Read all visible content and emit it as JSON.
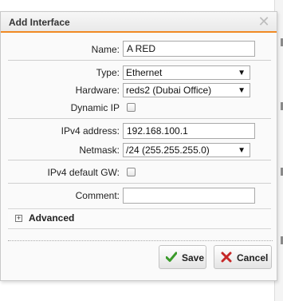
{
  "dialog": {
    "title": "Add Interface",
    "close_glyph": "✕"
  },
  "form": {
    "name": {
      "label": "Name:",
      "value": "A RED"
    },
    "type": {
      "label": "Type:",
      "value": "Ethernet"
    },
    "hardware": {
      "label": "Hardware:",
      "value": "reds2 (Dubai Office)"
    },
    "dynamic_ip": {
      "label": "Dynamic IP",
      "checked": false
    },
    "ipv4_address": {
      "label": "IPv4 address:",
      "value": "192.168.100.1"
    },
    "netmask": {
      "label": "Netmask:",
      "value": "/24 (255.255.255.0)"
    },
    "ipv4_default_gw": {
      "label": "IPv4 default GW:",
      "checked": false
    },
    "comment": {
      "label": "Comment:",
      "value": ""
    }
  },
  "advanced": {
    "label": "Advanced",
    "expand_glyph": "+"
  },
  "buttons": {
    "save": {
      "label": "Save",
      "icon": "check-icon",
      "color": "#3a9a2a"
    },
    "cancel": {
      "label": "Cancel",
      "icon": "x-icon",
      "color": "#c62828"
    }
  },
  "colors": {
    "accent": "#f08a24"
  }
}
